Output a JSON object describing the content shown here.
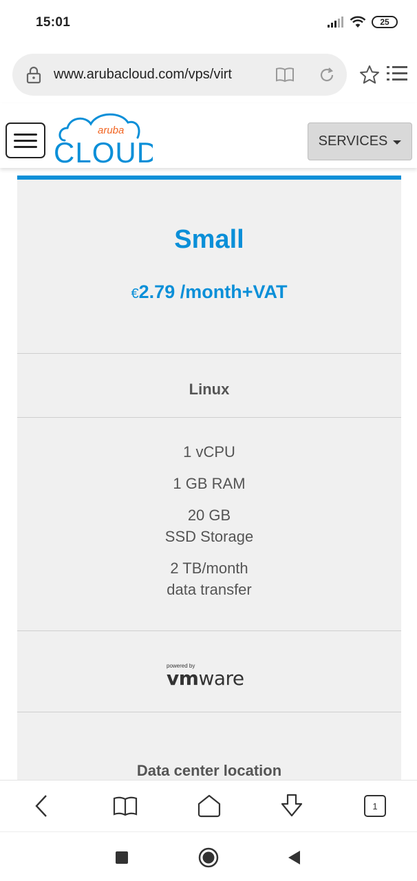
{
  "status_bar": {
    "time": "15:01",
    "battery": "25"
  },
  "browser": {
    "url": "www.arubacloud.com/vps/virt",
    "tab_count": "1"
  },
  "header": {
    "logo_small": "aruba",
    "logo_large": "CLOUD",
    "services_label": "SERVICES",
    "brand_color": "#0a8fd8",
    "accent_color": "#f26522"
  },
  "plan": {
    "name": "Small",
    "currency": "€",
    "price": "2.79",
    "period": " /month+VAT",
    "os": "Linux",
    "specs": [
      {
        "line1": "1 vCPU",
        "line2": ""
      },
      {
        "line1": "1 GB RAM",
        "line2": ""
      },
      {
        "line1": "20 GB",
        "line2": "SSD Storage"
      },
      {
        "line1": "2 TB/month",
        "line2": "data transfer"
      }
    ],
    "powered_by": "powered by",
    "vmware_vm": "vm",
    "vmware_ware": "ware",
    "datacenter_label": "Data center location",
    "accent_color": "#0a8fd8"
  },
  "icons": {
    "lock": "lock-icon",
    "reader": "reader-mode-icon",
    "reload": "reload-icon",
    "star": "star-icon",
    "menu": "list-menu-icon",
    "back": "back-icon",
    "bookmarks": "bookmarks-icon",
    "home": "home-icon",
    "download": "download-icon"
  }
}
